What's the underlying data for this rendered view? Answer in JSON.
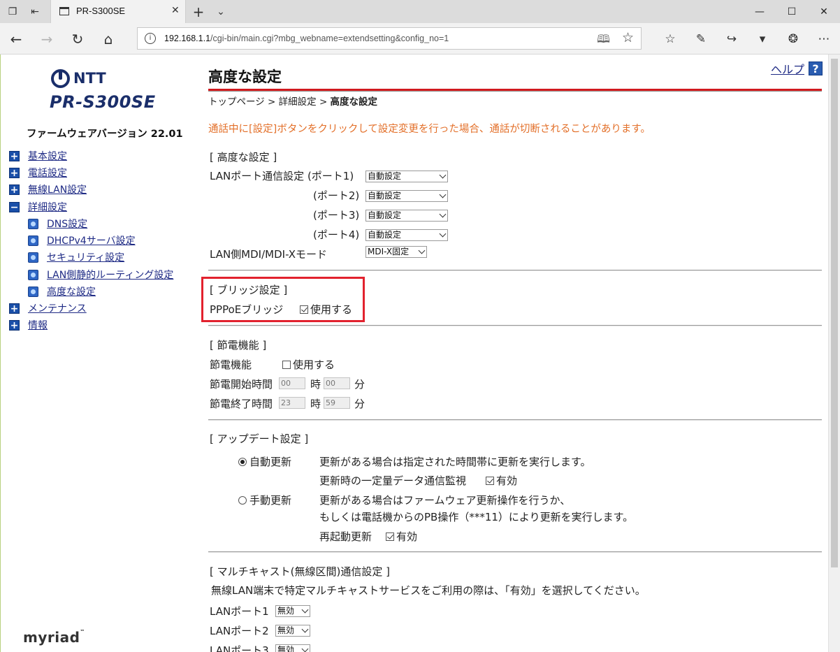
{
  "browser": {
    "tab_title": "PR-S300SE",
    "url_host": "192.168.1.1",
    "url_path": "/cgi-bin/main.cgi?mbg_webname=extendsetting&config_no=1",
    "icons": [
      "tab-preview-icon",
      "set-aside-icon",
      "favicon-page-icon",
      "close-tab-icon",
      "new-tab-icon",
      "tab-list-icon",
      "minimize-icon",
      "maximize-icon",
      "close-window-icon",
      "back-icon",
      "forward-icon",
      "refresh-icon",
      "home-icon",
      "site-info-icon",
      "reading-view-icon",
      "favorite-star-icon",
      "favorites-hub-icon",
      "ink-icon",
      "share-icon",
      "pocket-icon",
      "evernote-icon",
      "more-icon"
    ]
  },
  "sidebar": {
    "brand": "NTT",
    "model": "PR-S300SE",
    "firmware": "ファームウェアバージョン 22.01",
    "menu": [
      {
        "label": "基本設定",
        "icon": "plus-icon"
      },
      {
        "label": "電話設定",
        "icon": "plus-icon"
      },
      {
        "label": "無線LAN設定",
        "icon": "plus-icon"
      },
      {
        "label": "詳細設定",
        "icon": "minus-icon"
      },
      {
        "label": "メンテナンス",
        "icon": "plus-icon"
      },
      {
        "label": "情報",
        "icon": "plus-icon"
      }
    ],
    "submenu": [
      {
        "label": "DNS設定"
      },
      {
        "label": "DHCPv4サーバ設定"
      },
      {
        "label": "セキュリティ設定"
      },
      {
        "label": "LAN側静的ルーティング設定"
      },
      {
        "label": "高度な設定"
      }
    ],
    "footer_logo": "myriad",
    "footer_tm": "™"
  },
  "main": {
    "title": "高度な設定",
    "help_label": "ヘルプ",
    "help_icon": "?",
    "breadcrumb": {
      "top": "トップページ",
      "sep": ">",
      "detail": "詳細設定",
      "current": "高度な設定"
    },
    "warning": "通話中に[設定]ボタンをクリックして設定変更を行った場合、通話が切断されることがあります。",
    "warning_color": "#e3702a",
    "advanced": {
      "heading": "[ 高度な設定 ]",
      "lan_port_label": "LANポート通信設定 (ポート1)",
      "port2_label": "(ポート2)",
      "port3_label": "(ポート3)",
      "port4_label": "(ポート4)",
      "port_value": "自動設定",
      "mdi_label": "LAN側MDI/MDI-Xモード",
      "mdi_value": "MDI-X固定"
    },
    "bridge": {
      "heading": "[ ブリッジ設定 ]",
      "pppoe_label": "PPPoEブリッジ",
      "pppoe_checkbox_label": "使用する",
      "pppoe_checked": true
    },
    "power_saving": {
      "heading": "[ 節電機能 ]",
      "label": "節電機能",
      "checkbox_label": "使用する",
      "checked": false,
      "start_label": "節電開始時間",
      "start_hour": "00",
      "start_min": "00",
      "end_label": "節電終了時間",
      "end_hour": "23",
      "end_min": "59",
      "hour_unit": "時",
      "min_unit": "分"
    },
    "update": {
      "heading": "[ アップデート設定 ]",
      "auto_label": "自動更新",
      "auto_selected": true,
      "auto_desc": "更新がある場合は指定された時間帯に更新を実行します。",
      "monitor_label": "更新時の一定量データ通信監視",
      "monitor_checkbox_label": "有効",
      "manual_label": "手動更新",
      "manual_desc1": "更新がある場合はファームウェア更新操作を行うか、",
      "manual_desc2": "もしくは電話機からのPB操作（***11）により更新を実行します。",
      "restart_label": "再起動更新",
      "restart_checkbox_label": "有効"
    },
    "multicast": {
      "heading": "[ マルチキャスト(無線区間)通信設定 ]",
      "desc": "無線LAN端末で特定マルチキャストサービスをご利用の際は、「有効」を選択してください。",
      "port1_label": "LANポート1",
      "port2_label": "LANポート2",
      "port3_label": "LANポート3",
      "value": "無効"
    },
    "highlight_color": "#e2222e"
  }
}
